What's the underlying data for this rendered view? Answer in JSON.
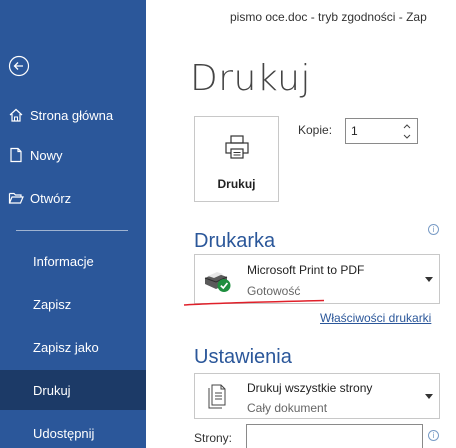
{
  "window": {
    "title": "pismo oce.doc  -  tryb zgodności  -  Zap"
  },
  "nav": {
    "back_icon": "back-arrow-icon",
    "items": [
      {
        "label": "Strona główna",
        "icon": "home-icon"
      },
      {
        "label": "Nowy",
        "icon": "new-document-icon"
      },
      {
        "label": "Otwórz",
        "icon": "folder-open-icon"
      },
      {
        "label": "Informacje"
      },
      {
        "label": "Zapisz"
      },
      {
        "label": "Zapisz jako"
      },
      {
        "label": "Drukuj",
        "active": true
      },
      {
        "label": "Udostępnij"
      }
    ],
    "colors": {
      "background": "#2b579a",
      "active": "#1c3a67"
    }
  },
  "main": {
    "title": "Drukuj",
    "print_button": {
      "label": "Drukuj",
      "icon": "printer-icon"
    },
    "copies": {
      "label": "Kopie:",
      "value": "1"
    },
    "printer_section": {
      "title": "Drukarka",
      "info_icon": "info-icon",
      "selected_printer": "Microsoft Print to PDF",
      "status": "Gotowość",
      "status_icon": "printer-ready-icon",
      "properties_link": "Właściwości drukarki"
    },
    "settings_section": {
      "title": "Ustawienia",
      "print_range": {
        "label": "Drukuj wszystkie strony",
        "sub": "Cały dokument",
        "icon": "pages-icon"
      },
      "pages": {
        "label": "Strony:",
        "value": ""
      }
    },
    "colors": {
      "accent": "#2b579a",
      "annotation": "#e0202a"
    }
  }
}
